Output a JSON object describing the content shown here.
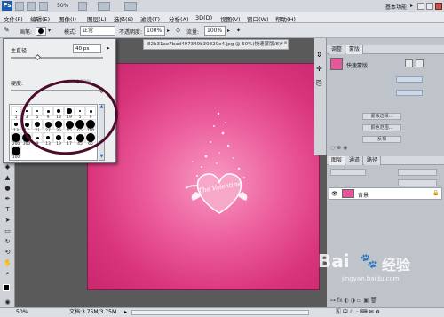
{
  "topbar": {
    "zoom": "50%",
    "workspace": "基本功能"
  },
  "menu": [
    "文件(F)",
    "编辑(E)",
    "图像(I)",
    "图层(L)",
    "选择(S)",
    "滤镜(T)",
    "分析(A)",
    "3D(D)",
    "视图(V)",
    "窗口(W)",
    "帮助(H)"
  ],
  "options": {
    "brush_label": "画笔:",
    "brush_size": "40",
    "mode_label": "模式:",
    "mode_value": "正常",
    "opacity_label": "不透明度:",
    "opacity_value": "100%",
    "flow_label": "流量:",
    "flow_value": "100%"
  },
  "brush_panel": {
    "diameter_label": "主直径",
    "diameter_value": "40 px",
    "hardness_label": "硬度:",
    "hardness_value": "100%",
    "numbers": [
      "1",
      "3",
      "5",
      "9",
      "13",
      "19",
      "5",
      "9",
      "13",
      "17",
      "21",
      "27",
      "35",
      "45",
      "65",
      "100",
      "200",
      "300",
      "9",
      "13",
      "19",
      "17",
      "45",
      "65",
      "100"
    ]
  },
  "document": {
    "tab_title": "82b31ae7bad497349b39820e4.jpg @ 50%(快速蒙版/8)*",
    "art_text": "The Valentine"
  },
  "panels": {
    "tabs_top": [
      "调整",
      "蒙版"
    ],
    "mask_title": "快速蒙版",
    "buttons": [
      "蒙版边缘...",
      "颜色范围...",
      "反相"
    ],
    "tabs_layers": [
      "图层",
      "通道",
      "路径"
    ],
    "layer_name": "背景"
  },
  "status": {
    "zoom": "50%",
    "doc": "文档:3.75M/3.75M"
  },
  "watermark": {
    "brand": "Bai",
    "brand2": "经验",
    "url": "jingyan.baidu.com"
  },
  "colors": {
    "canvas_pink": "#e0467f",
    "ps_blue": "#1c5ea8"
  }
}
